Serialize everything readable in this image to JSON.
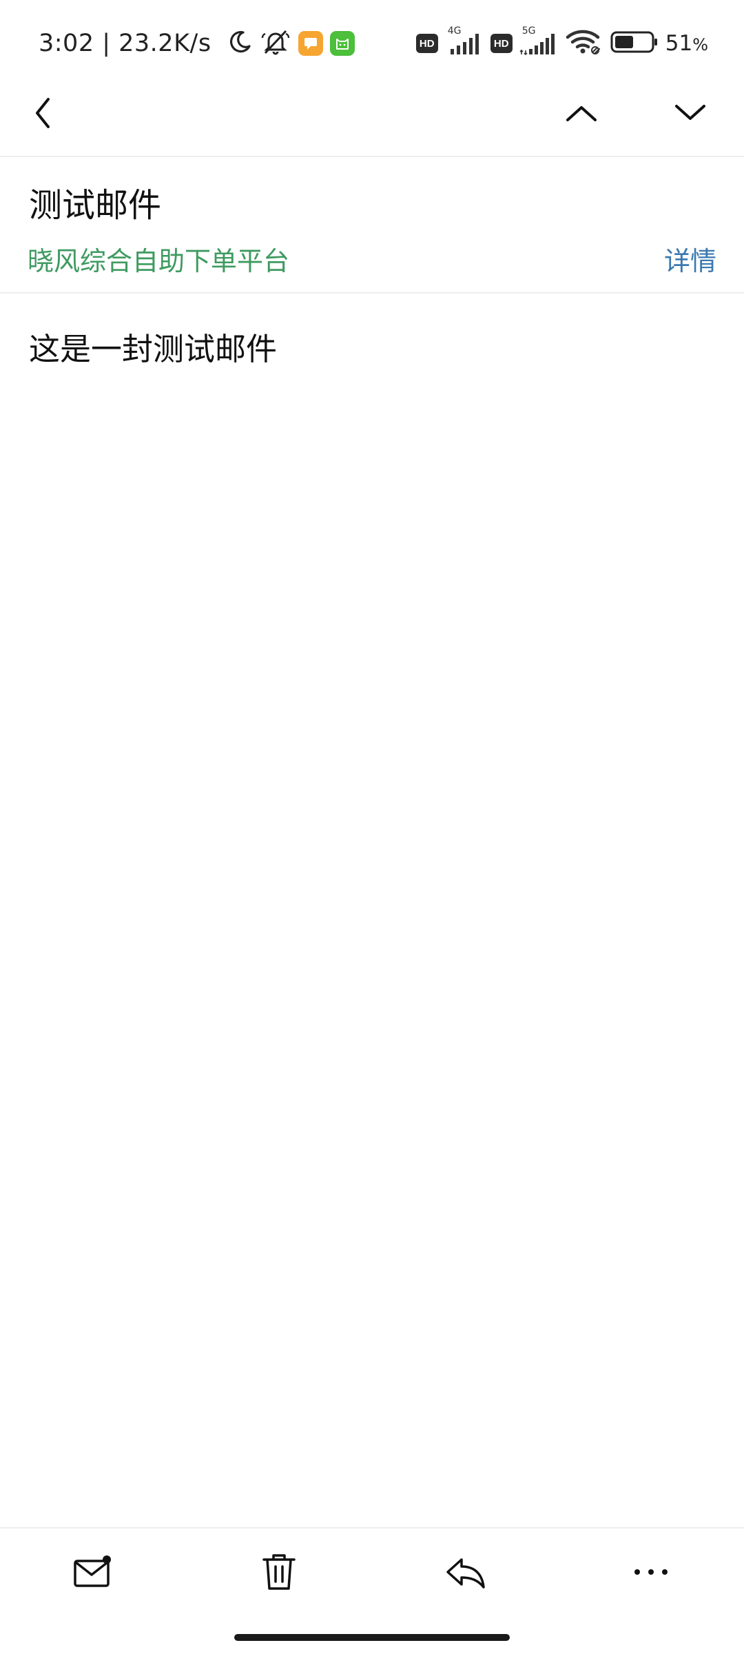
{
  "status_bar": {
    "time": "3:02 | 23.2K/s",
    "hd_label": "HD",
    "network_1": "4G",
    "network_2": "5G",
    "battery_level": 51,
    "battery_text": "51",
    "battery_unit": "%",
    "icons": [
      "moon-icon",
      "silent-bell-icon",
      "message-app-badge",
      "cat-app-badge",
      "signal-icon",
      "wifi-icon",
      "battery-icon"
    ]
  },
  "top_nav": {
    "icons": [
      "back-icon",
      "chevron-up-icon",
      "chevron-down-icon"
    ]
  },
  "mail": {
    "subject": "测试邮件",
    "sender": "晓风综合自助下单平台",
    "details_label": "详情",
    "body": "这是一封测试邮件"
  },
  "bottom_toolbar": {
    "icons": [
      "mail-unread-icon",
      "trash-icon",
      "reply-icon",
      "more-icon"
    ]
  },
  "colors": {
    "sender": "#3f9a60",
    "link": "#3a78b0",
    "badge_orange": "#f7a531",
    "badge_green": "#4cbf3b",
    "divider": "#eeeeee"
  }
}
